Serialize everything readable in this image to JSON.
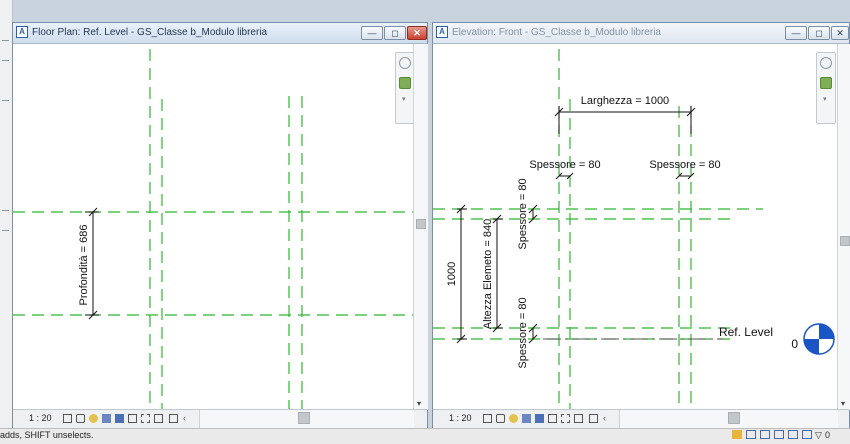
{
  "left_view": {
    "title": "Floor Plan: Ref. Level - GS_Classe b_Modulo libreria",
    "scale": "1 : 20",
    "buttons": {
      "minimize": "—",
      "restore": "◻",
      "close": "✕"
    },
    "dimensions": {
      "depth": "Profondità = 686"
    }
  },
  "right_view": {
    "title": "Elevation: Front - GS_Classe b_Modulo libreria",
    "scale": "1 : 20",
    "buttons": {
      "minimize": "—",
      "restore": "◻",
      "close": "✕"
    },
    "dimensions": {
      "width": "Larghezza = 1000",
      "thickness_left": "Spessore = 80",
      "thickness_right": "Spessore = 80",
      "thickness_top": "Spessore = 80",
      "thickness_bottom": "Spessore = 80",
      "height": "1000",
      "element_height": "Altezza Elemeto = 840"
    },
    "level": {
      "name": "Ref. Level",
      "elevation": "0"
    }
  },
  "status": {
    "hint": "adds, SHIFT unselects.",
    "tray": "0"
  },
  "colors": {
    "ref_plane": "#2fb82f",
    "level_marker": "#1a55c8",
    "dimension": "#111111"
  }
}
